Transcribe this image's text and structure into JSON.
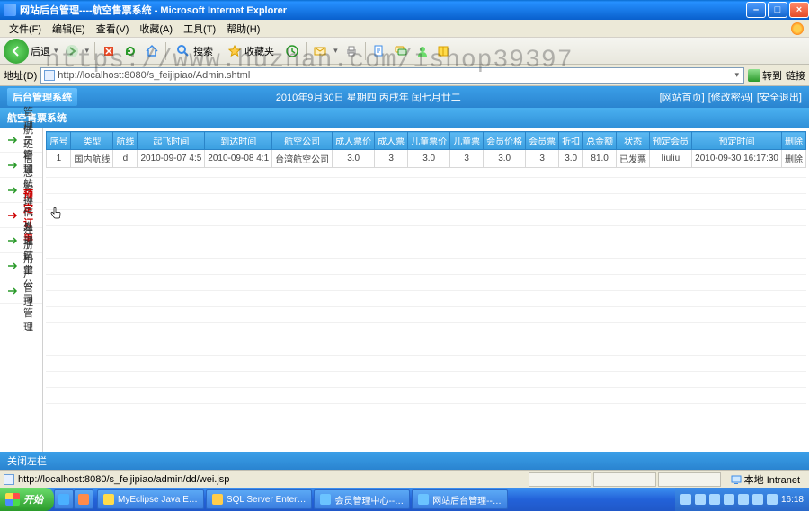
{
  "window": {
    "title": "网站后台管理----航空售票系统 - Microsoft Internet Explorer"
  },
  "menu": [
    "文件(F)",
    "编辑(E)",
    "查看(V)",
    "收藏(A)",
    "工具(T)",
    "帮助(H)"
  ],
  "toolbar": {
    "back": "后退",
    "search": "搜索",
    "favorites": "收藏夹"
  },
  "address": {
    "label": "地址(D)",
    "url": "http://localhost:8080/s_feijipiao/Admin.shtml",
    "go": "转到",
    "links": "链接"
  },
  "appHeader": {
    "logo": "后台管理系统",
    "date": "2010年9月30日 星期四 丙戌年 闰七月廿二",
    "links": [
      "[网站首页]",
      "[修改密码]",
      "[安全退出]"
    ],
    "sub": "航空售票系统"
  },
  "sidebar": [
    {
      "label": "管理员管理"
    },
    {
      "label": "航班信息管理"
    },
    {
      "label": "增加航班信息"
    },
    {
      "label": "预定订单"
    },
    {
      "label": "已处理订单"
    },
    {
      "label": "注册用户管理"
    },
    {
      "label": "航空公司管理"
    }
  ],
  "table": {
    "headers": [
      "序号",
      "类型",
      "航线",
      "起飞时间",
      "到达时间",
      "航空公司",
      "成人票价",
      "成人票",
      "儿童票价",
      "儿童票",
      "会员价格",
      "会员票",
      "折扣",
      "总金额",
      "状态",
      "预定会员",
      "预定时间",
      "删除"
    ],
    "rows": [
      [
        "1",
        "国内航线",
        "d",
        "2010-09-07 4:5",
        "2010-09-08 4:1",
        "台湾航空公司",
        "3.0",
        "3",
        "3.0",
        "3",
        "3.0",
        "3",
        "3.0",
        "81.0",
        "已发票",
        "liuliu",
        "2010-09-30 16:17:30",
        "删除"
      ]
    ]
  },
  "footer": {
    "link": "关闭左栏"
  },
  "statusbar": {
    "url": "http://localhost:8080/s_feijipiao/admin/dd/wei.jsp",
    "zone": "本地 Intranet"
  },
  "taskbar": {
    "start": "开始",
    "buttons": [
      "MyEclipse Java E…",
      "SQL Server Enter…",
      "会员管理中心--…",
      "网站后台管理--…"
    ],
    "clock": "16:18"
  },
  "watermark": "https://www.huzhan.com/ishop39397"
}
